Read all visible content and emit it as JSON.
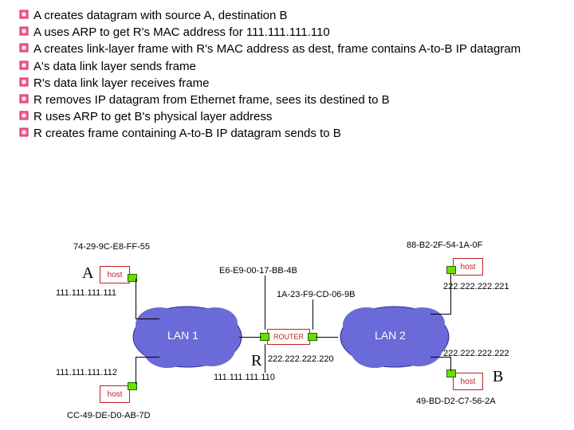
{
  "bullets": [
    "A creates datagram with source A, destination B",
    "A uses ARP to get R's MAC address for 111.111.111.110",
    "A creates link-layer frame with R's MAC address as dest, frame contains A-to-B IP datagram",
    "A's data link layer sends frame",
    "R's data link layer receives frame",
    "R removes IP datagram from Ethernet frame, sees its destined to B",
    "R uses ARP to get B's physical layer address",
    "R creates frame containing A-to-B IP datagram sends to B"
  ],
  "labels": {
    "A": "A",
    "B": "B",
    "R": "R",
    "lan1": "LAN 1",
    "lan2": "LAN 2",
    "host": "host",
    "router": "ROUTER"
  },
  "mac": {
    "A": "74-29-9C-E8-FF-55",
    "host2": "CC-49-DE-D0-AB-7D",
    "R_left": "E6-E9-00-17-BB-4B",
    "R_right": "1A-23-F9-CD-06-9B",
    "hostTR": "88-B2-2F-54-1A-0F",
    "B": "49-BD-D2-C7-56-2A"
  },
  "ip": {
    "A": "111.111.111.111",
    "host2": "111.111.111.112",
    "R_left": "111.111.111.110",
    "R_right": "222.222.222.220",
    "hostTR": "222.222.222.221",
    "B": "222.222.222.222"
  }
}
